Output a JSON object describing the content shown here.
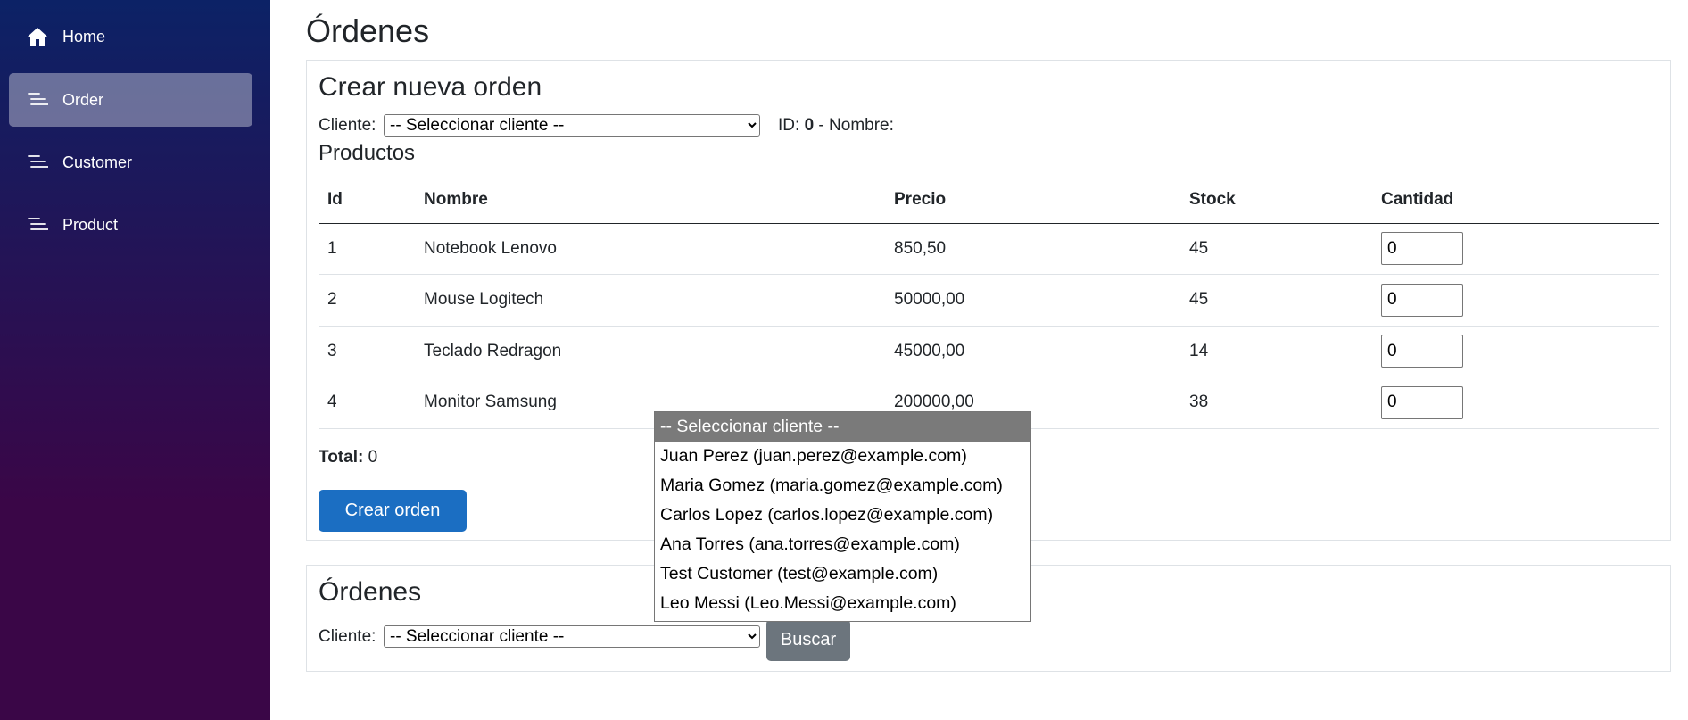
{
  "sidebar": {
    "items": [
      {
        "label": "Home",
        "icon": "home-icon",
        "active": false
      },
      {
        "label": "Order",
        "icon": "list-icon",
        "active": true
      },
      {
        "label": "Customer",
        "icon": "list-icon",
        "active": false
      },
      {
        "label": "Product",
        "icon": "list-icon",
        "active": false
      }
    ]
  },
  "page": {
    "title": "Órdenes"
  },
  "create": {
    "title": "Crear nueva orden",
    "client_label": "Cliente:",
    "client_selected": "-- Seleccionar cliente --",
    "id_label": "ID:",
    "id_value": "0",
    "name_label": "- Nombre:",
    "products_title": "Productos",
    "columns": [
      "Id",
      "Nombre",
      "Precio",
      "Stock",
      "Cantidad"
    ],
    "rows": [
      {
        "id": "1",
        "name": "Notebook Lenovo",
        "price": "850,50",
        "stock": "45",
        "qty": "0"
      },
      {
        "id": "2",
        "name": "Mouse Logitech",
        "price": "50000,00",
        "stock": "45",
        "qty": "0"
      },
      {
        "id": "3",
        "name": "Teclado Redragon",
        "price": "45000,00",
        "stock": "14",
        "qty": "0"
      },
      {
        "id": "4",
        "name": "Monitor Samsung",
        "price": "200000,00",
        "stock": "38",
        "qty": "0"
      }
    ],
    "total_label": "Total:",
    "total_value": "0",
    "create_button": "Crear orden"
  },
  "orders": {
    "title": "Órdenes",
    "client_label": "Cliente:",
    "client_selected": "-- Seleccionar cliente --",
    "search_button": "Buscar"
  },
  "dropdown": {
    "options": [
      "-- Seleccionar cliente --",
      "Juan Perez (juan.perez@example.com)",
      "Maria Gomez (maria.gomez@example.com)",
      "Carlos Lopez (carlos.lopez@example.com)",
      "Ana Torres (ana.torres@example.com)",
      "Test Customer (test@example.com)",
      "Leo Messi (Leo.Messi@example.com)"
    ],
    "highlighted_index": 0
  },
  "colors": {
    "sidebar_top": "#0c2266",
    "sidebar_bottom": "#3a0647",
    "primary": "#1b6ec2",
    "secondary": "#6c757d"
  }
}
